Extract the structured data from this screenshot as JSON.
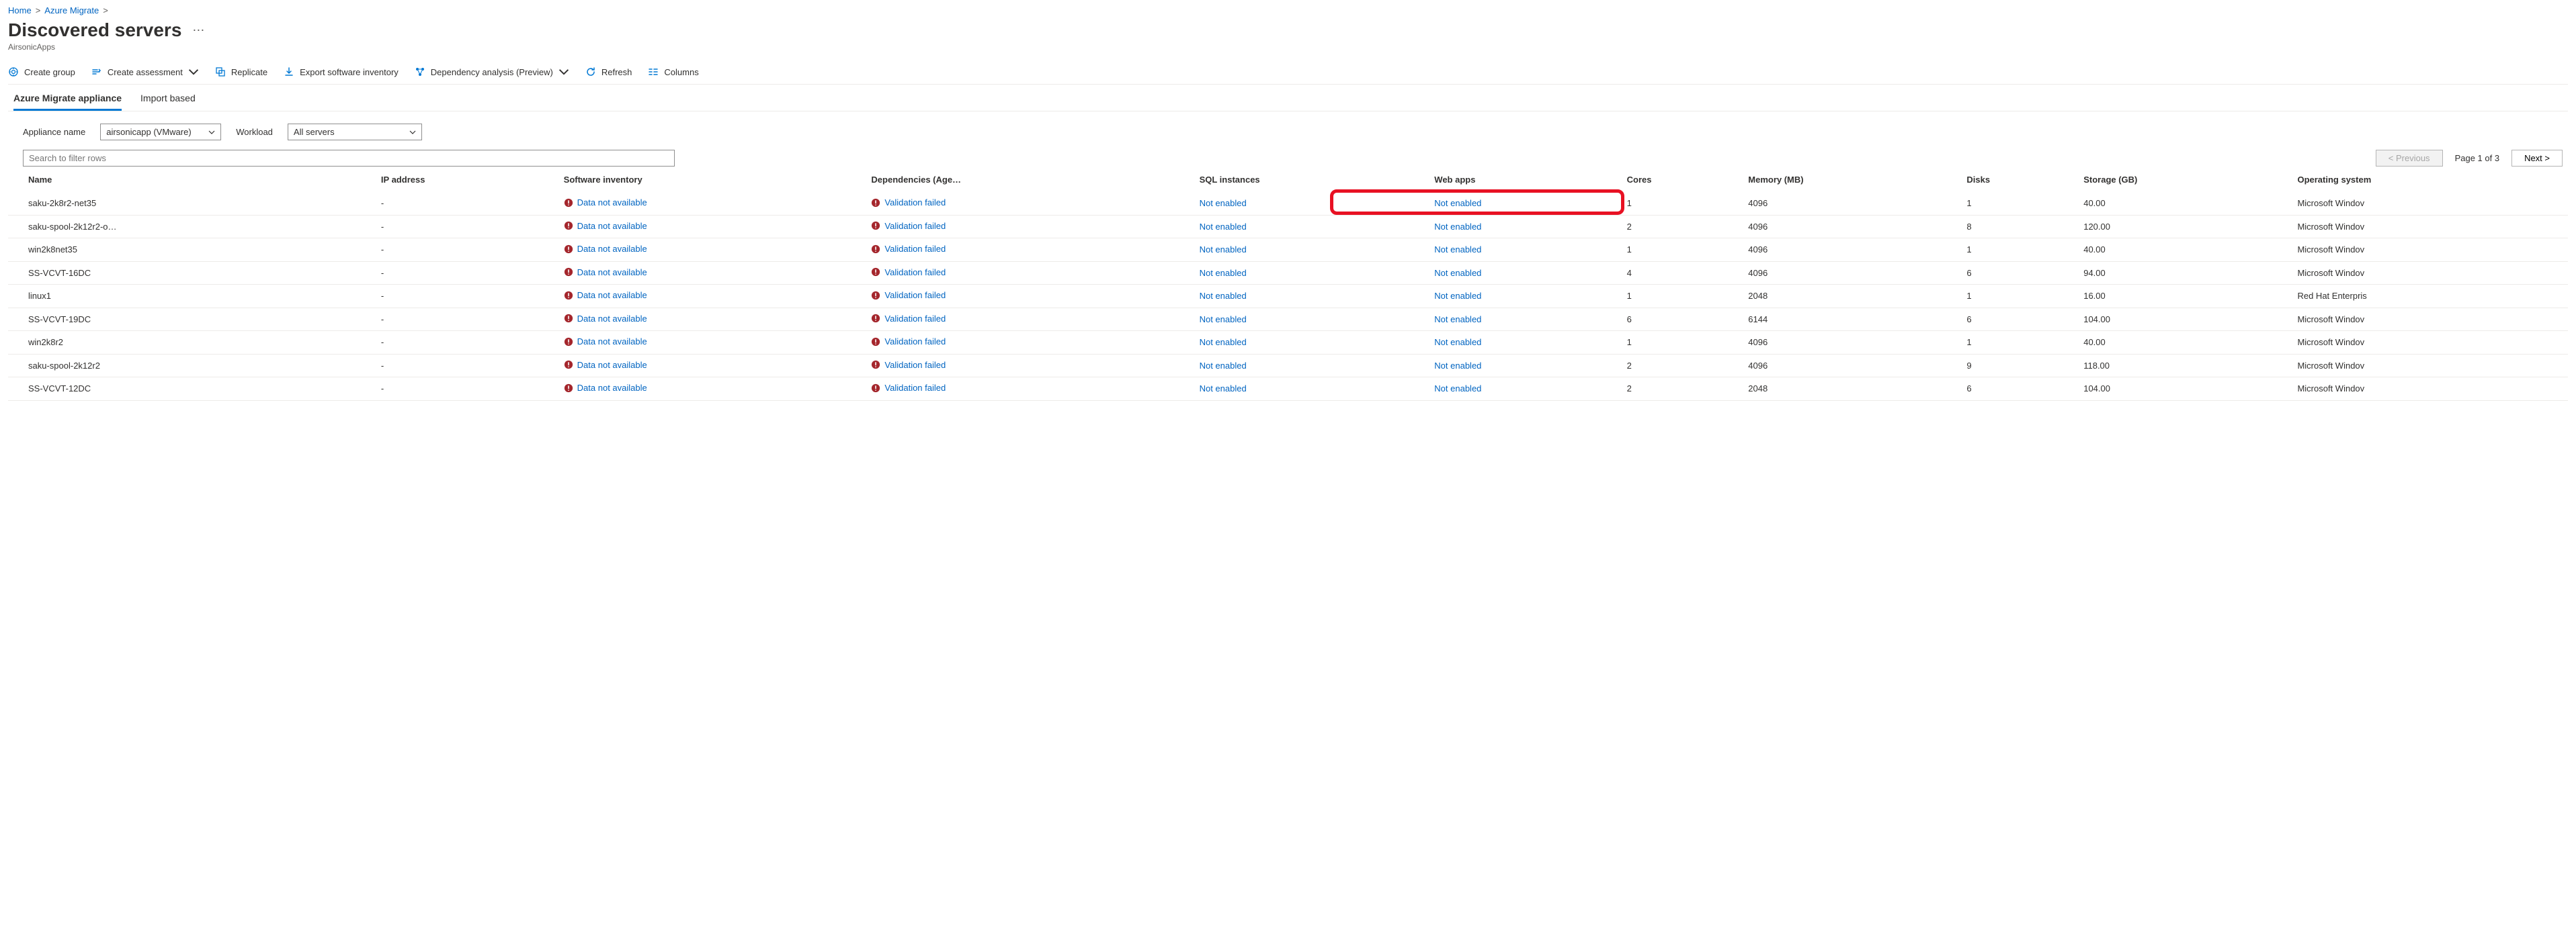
{
  "breadcrumb": [
    "Home",
    "Azure Migrate"
  ],
  "title": "Discovered servers",
  "project": "AirsonicApps",
  "toolbar": {
    "create_group": "Create group",
    "create_assessment": "Create assessment",
    "replicate": "Replicate",
    "export": "Export software inventory",
    "dependency": "Dependency analysis (Preview)",
    "refresh": "Refresh",
    "columns": "Columns"
  },
  "tabs": {
    "appliance": "Azure Migrate appliance",
    "import": "Import based"
  },
  "filters": {
    "appliance_label": "Appliance name",
    "appliance_value": "airsonicapp (VMware)",
    "workload_label": "Workload",
    "workload_value": "All servers"
  },
  "search_placeholder": "Search to filter rows",
  "pager": {
    "prev": "< Previous",
    "info": "Page 1 of 3",
    "next": "Next >"
  },
  "columns": {
    "name": "Name",
    "ip": "IP address",
    "soft": "Software inventory",
    "dep": "Dependencies (Age…",
    "sql": "SQL instances",
    "web": "Web apps",
    "cores": "Cores",
    "mem": "Memory (MB)",
    "disks": "Disks",
    "storage": "Storage (GB)",
    "os": "Operating system"
  },
  "cell_text": {
    "data_na": "Data not available",
    "val_fail": "Validation failed",
    "not_enabled": "Not enabled",
    "dash": "-"
  },
  "rows": [
    {
      "name": "saku-2k8r2-net35",
      "cores": "1",
      "mem": "4096",
      "disks": "1",
      "storage": "40.00",
      "os": "Microsoft Windov",
      "hl": true
    },
    {
      "name": "saku-spool-2k12r2-o…",
      "cores": "2",
      "mem": "4096",
      "disks": "8",
      "storage": "120.00",
      "os": "Microsoft Windov"
    },
    {
      "name": "win2k8net35",
      "cores": "1",
      "mem": "4096",
      "disks": "1",
      "storage": "40.00",
      "os": "Microsoft Windov"
    },
    {
      "name": "SS-VCVT-16DC",
      "cores": "4",
      "mem": "4096",
      "disks": "6",
      "storage": "94.00",
      "os": "Microsoft Windov"
    },
    {
      "name": "linux1",
      "cores": "1",
      "mem": "2048",
      "disks": "1",
      "storage": "16.00",
      "os": "Red Hat Enterpris"
    },
    {
      "name": "SS-VCVT-19DC",
      "cores": "6",
      "mem": "6144",
      "disks": "6",
      "storage": "104.00",
      "os": "Microsoft Windov"
    },
    {
      "name": "win2k8r2",
      "cores": "1",
      "mem": "4096",
      "disks": "1",
      "storage": "40.00",
      "os": "Microsoft Windov"
    },
    {
      "name": "saku-spool-2k12r2",
      "cores": "2",
      "mem": "4096",
      "disks": "9",
      "storage": "118.00",
      "os": "Microsoft Windov"
    },
    {
      "name": "SS-VCVT-12DC",
      "cores": "2",
      "mem": "2048",
      "disks": "6",
      "storage": "104.00",
      "os": "Microsoft Windov"
    }
  ]
}
